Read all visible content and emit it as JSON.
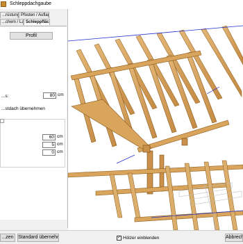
{
  "window": {
    "title": "Schleppdachgaube",
    "icon": "dormer-app-icon"
  },
  "tabs_row1": [
    {
      "label": "...rüstung"
    },
    {
      "label": "Pfosten / Auflager"
    }
  ],
  "tabs_row2": [
    {
      "label": "...chern / Laden"
    },
    {
      "label": "Schleppfläche",
      "active": true
    }
  ],
  "panel": {
    "profil_button": "Profil",
    "length_label": "...s:",
    "length_value": "80",
    "length_unit": "cm",
    "adopt_label": "...stdach übernehmen",
    "group2": {
      "rows": [
        {
          "value": "60",
          "unit": "cm"
        },
        {
          "value": "5",
          "unit": "cm"
        },
        {
          "value": "0",
          "unit": "cm"
        }
      ]
    }
  },
  "bottom": {
    "left_button": "...zen",
    "standard_button": "Standard übernehmen",
    "woods_checkbox_label": "Hölzer einblenden",
    "woods_checked": true,
    "cancel_button": "Abbrech..."
  },
  "colors": {
    "wood": "#d9a55c",
    "wood_dark": "#b07a34",
    "accent_blue": "#1f2fd0",
    "panel_bg": "#f0f0f0"
  }
}
